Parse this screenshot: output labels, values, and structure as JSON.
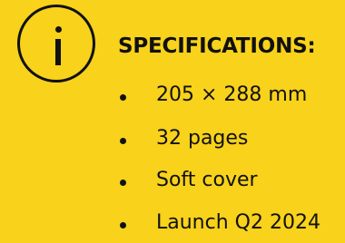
{
  "icon": {
    "name": "info-icon"
  },
  "title": "SPECIFICATIONS:",
  "specs": [
    {
      "text": "205 × 288 mm"
    },
    {
      "text": "32 pages"
    },
    {
      "text": "Soft cover"
    },
    {
      "text": "Launch Q2 2024"
    }
  ],
  "colors": {
    "background": "#f8d21b",
    "foreground": "#111111"
  }
}
